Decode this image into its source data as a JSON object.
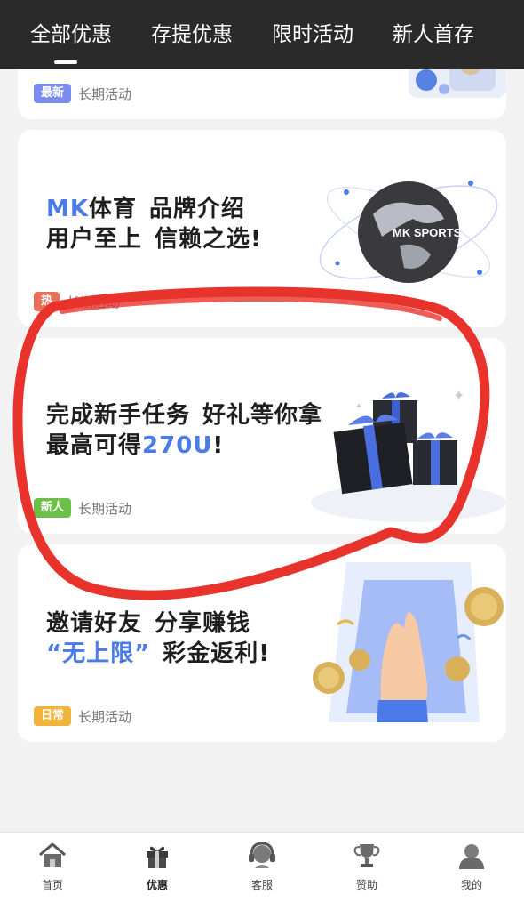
{
  "tabs": [
    {
      "label": "全部优惠"
    },
    {
      "label": "存提优惠"
    },
    {
      "label": "限时活动"
    },
    {
      "label": "新人首存"
    }
  ],
  "cards": [
    {
      "badge": "最新",
      "badge_color": "#7b8cf0",
      "period": "长期活动"
    },
    {
      "line1_blue": "MK",
      "line1_rest": "体育",
      "line1_b": "品牌介绍",
      "line2_a": "用户至上",
      "line2_b": "信赖之选!",
      "badge": "热",
      "badge_color": "#e8705a",
      "period": "长期活动",
      "globe_text": "MK SPORTS"
    },
    {
      "line1_a": "完成新手任务",
      "line1_b": "好礼等你拿",
      "line2_a": "最高可得",
      "line2_blue": "270U",
      "line2_end": "!",
      "badge": "新人",
      "badge_color": "#6cc04a",
      "period": "长期活动"
    },
    {
      "line1_a": "邀请好友",
      "line1_b": "分享赚钱",
      "line2_blue": "“无上限”",
      "line2_rest": "彩金返利!",
      "badge": "日常",
      "badge_color": "#f0b43a",
      "period": "长期活动"
    }
  ],
  "nav": [
    {
      "label": "首页"
    },
    {
      "label": "优惠"
    },
    {
      "label": "客服"
    },
    {
      "label": "赞助"
    },
    {
      "label": "我的"
    }
  ]
}
